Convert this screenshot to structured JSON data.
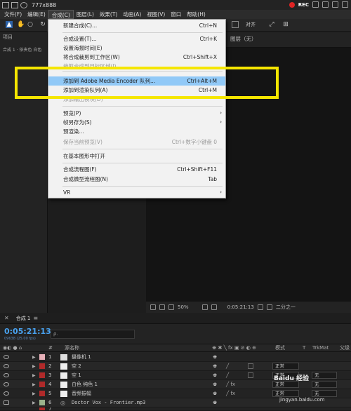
{
  "window": {
    "title": "777x888",
    "rec_label": "REC"
  },
  "menubar": [
    "文件(F)",
    "编辑(E)",
    "合成(C)",
    "图层(L)",
    "效果(T)",
    "动画(A)",
    "视图(V)",
    "窗口",
    "帮助(H)"
  ],
  "left_panel": {
    "tab1": "项目",
    "tab2": "合成 1 · 依夹色 白色"
  },
  "viewer": {
    "tab": "图层（无）",
    "align_label": "对齐",
    "zoom": "50%",
    "time": "0:05:21:13",
    "view": "二分之一"
  },
  "dropdown": {
    "items": [
      {
        "label": "新建合成(C)...",
        "shortcut": "Ctrl+N"
      },
      {
        "label": "合成设置(T)...",
        "shortcut": "Ctrl+K"
      },
      {
        "label": "设置海报时间(E)",
        "shortcut": ""
      },
      {
        "label": "将合成裁剪到工作区(W)",
        "shortcut": "Ctrl+Shift+X"
      },
      {
        "label": "裁剪合成到目标区域(I)",
        "shortcut": ""
      },
      {
        "label": "添加到 Adobe Media Encoder 队列...",
        "shortcut": "Ctrl+Alt+M"
      },
      {
        "label": "添加到渲染队列(A)",
        "shortcut": "Ctrl+M"
      },
      {
        "label": "添加输出模块(D)",
        "shortcut": ""
      },
      {
        "label": "预览(P)",
        "shortcut": ""
      },
      {
        "label": "帧另存为(S)",
        "shortcut": ""
      },
      {
        "label": "预渲染...",
        "shortcut": ""
      },
      {
        "label": "保存当前预览(V)",
        "shortcut": "Ctrl+数字小键盘 0"
      },
      {
        "label": "在基本图形中打开",
        "shortcut": ""
      },
      {
        "label": "合成流程图(F)",
        "shortcut": "Ctrl+Shift+F11"
      },
      {
        "label": "合成微型流程图(N)",
        "shortcut": "Tab"
      },
      {
        "label": "VR",
        "shortcut": ""
      }
    ]
  },
  "timeline": {
    "tab": "合成 1",
    "timecode": "0:05:21:13",
    "framerate": "09638 (25.00 fps)",
    "search_placeholder": "ρ.",
    "headers": {
      "name": "源名称",
      "mode": "模式",
      "t": "T",
      "trkmat": "TrkMat",
      "parent": "父级"
    },
    "layers": [
      {
        "num": "1",
        "name": "摄像机 1",
        "color": "#e6b0b8",
        "mode": "",
        "trk": ""
      },
      {
        "num": "2",
        "name": "空 2",
        "color": "#b02a2a",
        "mode": "正常",
        "trk": ""
      },
      {
        "num": "3",
        "name": "空 1",
        "color": "#b02a2a",
        "mode": "正常",
        "trk": "无"
      },
      {
        "num": "4",
        "name": "白色 纯色 1",
        "color": "#b02a2a",
        "mode": "正常",
        "trk": "无"
      },
      {
        "num": "5",
        "name": "音频振幅",
        "color": "#b02a2a",
        "mode": "正常",
        "trk": "无"
      },
      {
        "num": "6",
        "name": "Doctor Vox - Frontier.mp3",
        "color": "#9bb38d",
        "mode": "",
        "trk": ""
      },
      {
        "num": "7",
        "name": "",
        "color": "#b02a2a",
        "mode": "",
        "trk": ""
      }
    ]
  },
  "watermark": {
    "text": "Baidu 经验",
    "url": "jingyan.baidu.com"
  },
  "colors": {
    "highlight": "#f5e600",
    "hover": "#91c9f7",
    "timecode": "#49a3f2"
  }
}
